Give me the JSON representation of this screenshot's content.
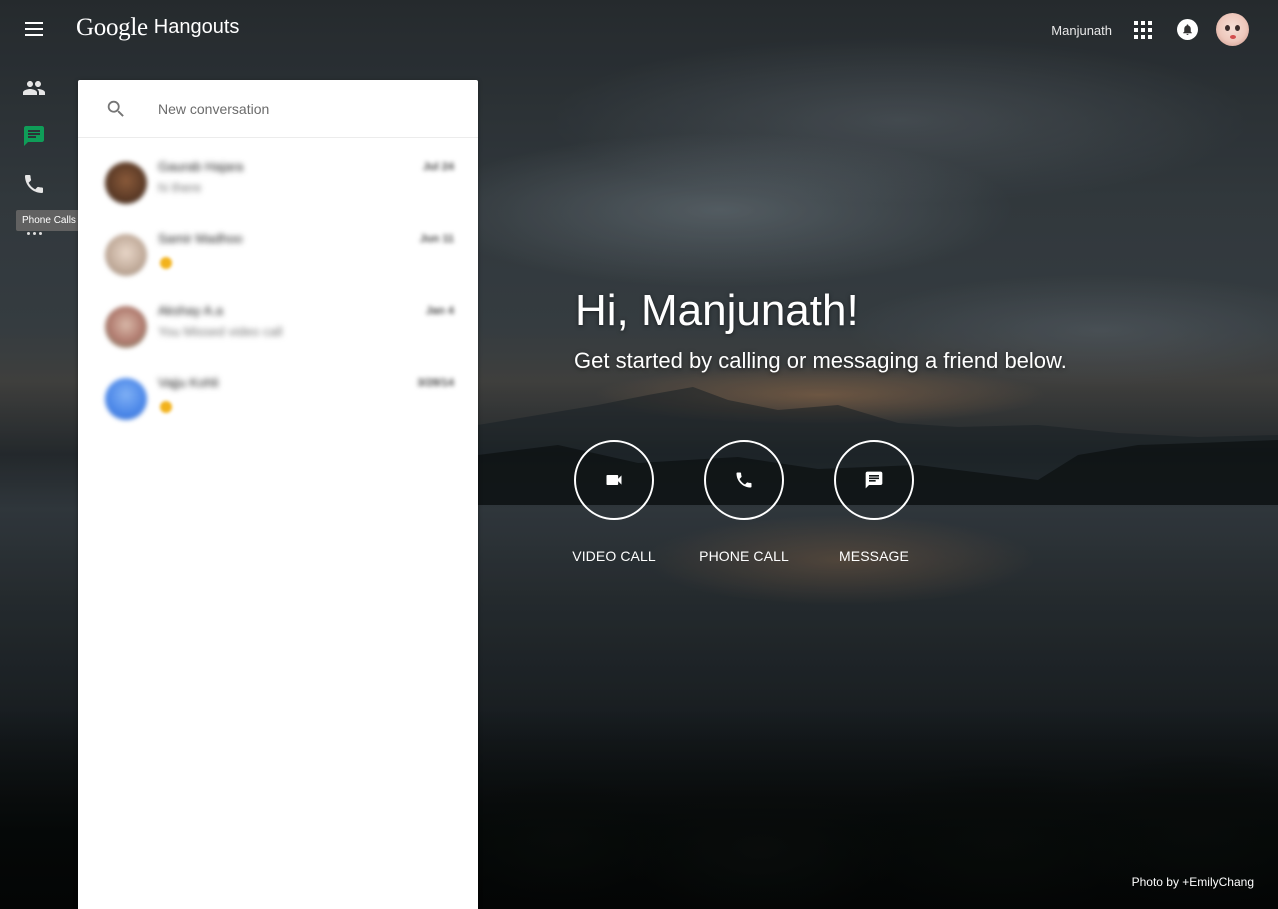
{
  "header": {
    "brand_google": "Google",
    "brand_product": "Hangouts",
    "user_name": "Manjunath",
    "apps_icon": "apps-grid-icon",
    "notifications_icon": "bell-icon"
  },
  "sidebar": {
    "items": [
      {
        "name": "contacts",
        "icon": "people-icon"
      },
      {
        "name": "messages",
        "icon": "chat-icon",
        "active": true,
        "color": "#0f9d58"
      },
      {
        "name": "phone-calls",
        "icon": "phone-icon"
      },
      {
        "name": "more",
        "icon": "more-horiz-icon"
      }
    ],
    "tooltip": "Phone Calls"
  },
  "search": {
    "placeholder": "New conversation"
  },
  "conversations": [
    {
      "name": "Gaurab Hajara",
      "preview": "hi there",
      "date": "Jul 24"
    },
    {
      "name": "Samir Madhoo",
      "preview": "",
      "date": "Jun 11",
      "emoji": true
    },
    {
      "name": "Akshay A.a",
      "preview": "You Missed video call",
      "date": "Jan 4"
    },
    {
      "name": "Vajju Kohli",
      "preview": "",
      "date": "3/28/14",
      "emoji": true
    }
  ],
  "hero": {
    "greeting": "Hi, Manjunath!",
    "subtitle": "Get started by calling or messaging a friend below.",
    "actions": [
      {
        "label": "VIDEO CALL",
        "icon": "videocam-icon"
      },
      {
        "label": "PHONE CALL",
        "icon": "phone-icon"
      },
      {
        "label": "MESSAGE",
        "icon": "message-icon"
      }
    ]
  },
  "footer": {
    "photo_credit": "Photo by +EmilyChang"
  },
  "colors": {
    "active_nav": "#0f9d58",
    "panel_bg": "#ffffff",
    "tooltip_bg": "#616161"
  }
}
